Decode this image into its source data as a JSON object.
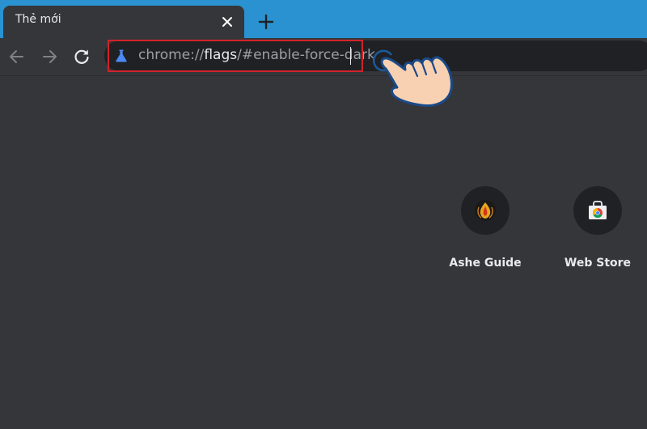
{
  "tab": {
    "title": "Thẻ mới",
    "close_icon": "close-icon"
  },
  "new_tab_icon": "plus-icon",
  "toolbar": {
    "back_icon": "arrow-back-icon",
    "forward_icon": "arrow-forward-icon",
    "reload_icon": "reload-icon"
  },
  "omnibox": {
    "icon": "flask-icon",
    "url_prefix": "chrome://",
    "url_host": "flags",
    "url_suffix": "/#enable-force-dark",
    "focus_outline_color": "#d0242a"
  },
  "shortcuts": [
    {
      "label": "Ashe Guide",
      "icon": "ashe-guide-favicon"
    },
    {
      "label": "Web Store",
      "icon": "chrome-web-store-icon"
    }
  ],
  "colors": {
    "tabstrip": "#2b92d1",
    "background": "#35363a",
    "omnibox": "#202124",
    "text": "#e8eaed",
    "flag_icon": "#4a8af4"
  }
}
